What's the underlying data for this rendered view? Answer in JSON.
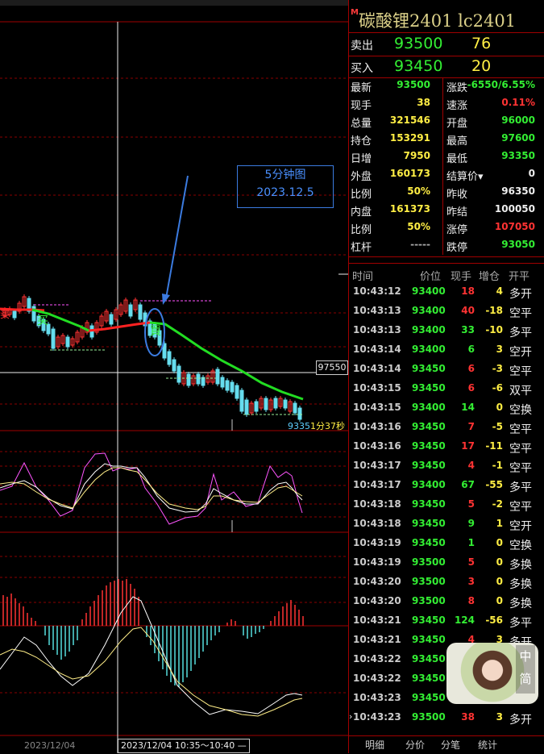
{
  "header": {
    "badge": "M",
    "title": "碳酸锂2401  lc2401"
  },
  "bid_ask": [
    {
      "label": "卖出",
      "price": "93500",
      "volume": "76"
    },
    {
      "label": "买入",
      "price": "93450",
      "volume": "20"
    }
  ],
  "quote": [
    {
      "l": "最新",
      "v": "93500",
      "vc": "#33ee33",
      "r": "涨跌",
      "v2": "-6550/6.55%",
      "v2c": "#33ee33"
    },
    {
      "l": "现手",
      "v": "38",
      "vc": "#ffee44",
      "r": "速涨",
      "v2": "0.11%",
      "v2c": "#ff3333"
    },
    {
      "l": "总量",
      "v": "321546",
      "vc": "#ffee44",
      "r": "开盘",
      "v2": "96000",
      "v2c": "#33ee33"
    },
    {
      "l": "持仓",
      "v": "153291",
      "vc": "#ffee44",
      "r": "最高",
      "v2": "97600",
      "v2c": "#33ee33"
    },
    {
      "l": "日增",
      "v": "7950",
      "vc": "#ffee44",
      "r": "最低",
      "v2": "93350",
      "v2c": "#33ee33"
    },
    {
      "l": "外盘",
      "v": "160173",
      "vc": "#ffee44",
      "r": "结算价▾",
      "v2": "0",
      "v2c": "#eeeeee"
    },
    {
      "l": "比例",
      "v": "50%",
      "vc": "#ffee44",
      "r": "昨收",
      "v2": "96350",
      "v2c": "#eeeeee"
    },
    {
      "l": "内盘",
      "v": "161373",
      "vc": "#ffee44",
      "r": "昨结",
      "v2": "100050",
      "v2c": "#eeeeee"
    },
    {
      "l": "比例",
      "v": "50%",
      "vc": "#ffee44",
      "r": "涨停",
      "v2": "107050",
      "v2c": "#ff3333"
    },
    {
      "l": "杠杆",
      "v": "-----",
      "vc": "#aaaaaa",
      "r": "跌停",
      "v2": "93050",
      "v2c": "#33ee33"
    }
  ],
  "ticks_header": {
    "time": "时间",
    "price": "价位",
    "vol": "现手",
    "oi": "增仓",
    "type": "开平"
  },
  "ticks": [
    {
      "t": "10:43:12",
      "p": "93400",
      "v": "18",
      "o": "4",
      "k": "多开",
      "pc": "#33ee33",
      "vcol": "#ff3333"
    },
    {
      "t": "10:43:13",
      "p": "93400",
      "v": "40",
      "o": "-18",
      "k": "空平",
      "pc": "#33ee33",
      "vcol": "#ff3333"
    },
    {
      "t": "10:43:13",
      "p": "93400",
      "v": "33",
      "o": "-10",
      "k": "多平",
      "pc": "#33ee33",
      "vcol": "#33ee33"
    },
    {
      "t": "10:43:14",
      "p": "93400",
      "v": "6",
      "o": "3",
      "k": "空开",
      "pc": "#33ee33",
      "vcol": "#33ee33"
    },
    {
      "t": "10:43:14",
      "p": "93450",
      "v": "6",
      "o": "-3",
      "k": "空平",
      "pc": "#33ee33",
      "vcol": "#ff3333"
    },
    {
      "t": "10:43:15",
      "p": "93450",
      "v": "6",
      "o": "-6",
      "k": "双平",
      "pc": "#33ee33",
      "vcol": "#ff3333"
    },
    {
      "t": "10:43:15",
      "p": "93400",
      "v": "14",
      "o": "0",
      "k": "空换",
      "pc": "#33ee33",
      "vcol": "#33ee33"
    },
    {
      "t": "10:43:16",
      "p": "93450",
      "v": "7",
      "o": "-5",
      "k": "空平",
      "pc": "#33ee33",
      "vcol": "#ff3333"
    },
    {
      "t": "10:43:16",
      "p": "93450",
      "v": "17",
      "o": "-11",
      "k": "空平",
      "pc": "#33ee33",
      "vcol": "#ff3333"
    },
    {
      "t": "10:43:17",
      "p": "93450",
      "v": "4",
      "o": "-1",
      "k": "空平",
      "pc": "#33ee33",
      "vcol": "#ff3333"
    },
    {
      "t": "10:43:17",
      "p": "93400",
      "v": "67",
      "o": "-55",
      "k": "多平",
      "pc": "#33ee33",
      "vcol": "#33ee33"
    },
    {
      "t": "10:43:18",
      "p": "93450",
      "v": "5",
      "o": "-2",
      "k": "空平",
      "pc": "#33ee33",
      "vcol": "#ff3333"
    },
    {
      "t": "10:43:18",
      "p": "93450",
      "v": "9",
      "o": "1",
      "k": "空开",
      "pc": "#33ee33",
      "vcol": "#33ee33"
    },
    {
      "t": "10:43:19",
      "p": "93450",
      "v": "1",
      "o": "0",
      "k": "空换",
      "pc": "#33ee33",
      "vcol": "#33ee33"
    },
    {
      "t": "10:43:19",
      "p": "93500",
      "v": "5",
      "o": "0",
      "k": "多换",
      "pc": "#33ee33",
      "vcol": "#ff3333"
    },
    {
      "t": "10:43:20",
      "p": "93500",
      "v": "3",
      "o": "0",
      "k": "多换",
      "pc": "#33ee33",
      "vcol": "#ff3333"
    },
    {
      "t": "10:43:20",
      "p": "93500",
      "v": "8",
      "o": "0",
      "k": "多换",
      "pc": "#33ee33",
      "vcol": "#ff3333"
    },
    {
      "t": "10:43:21",
      "p": "93450",
      "v": "124",
      "o": "-56",
      "k": "多平",
      "pc": "#33ee33",
      "vcol": "#33ee33"
    },
    {
      "t": "10:43:21",
      "p": "93450",
      "v": "4",
      "o": "3",
      "k": "多开",
      "pc": "#33ee33",
      "vcol": "#ff3333"
    },
    {
      "t": "10:43:22",
      "p": "93450",
      "v": "",
      "o": "",
      "k": "",
      "pc": "#33ee33",
      "vcol": "#ff3333"
    },
    {
      "t": "10:43:22",
      "p": "93450",
      "v": "",
      "o": "",
      "k": "",
      "pc": "#33ee33",
      "vcol": "#ff3333"
    },
    {
      "t": "10:43:23",
      "p": "93450",
      "v": "",
      "o": "",
      "k": "",
      "pc": "#33ee33",
      "vcol": "#ff3333"
    },
    {
      "t": "10:43:23",
      "p": "93500",
      "v": "38",
      "o": "3",
      "k": "多开",
      "pc": "#33ee33",
      "vcol": "#ff3333"
    }
  ],
  "tabs": [
    "明细",
    "分价",
    "分笔",
    "统计"
  ],
  "avatar_tags": [
    "中",
    "简"
  ],
  "chart": {
    "annotation_line1": "5分钟图",
    "annotation_line2": "2023.12.5",
    "crosshair_price": "97550",
    "last_price": "9335",
    "countdown": "1分37秒",
    "date_left": "2023/12/04",
    "time_range": "2023/12/04 10:35～10:40 —",
    "signal_mark": "买"
  },
  "colors": {
    "up": "#ff3333",
    "down": "#33ee33",
    "frame": "#a00000",
    "yellow": "#ffee44"
  }
}
